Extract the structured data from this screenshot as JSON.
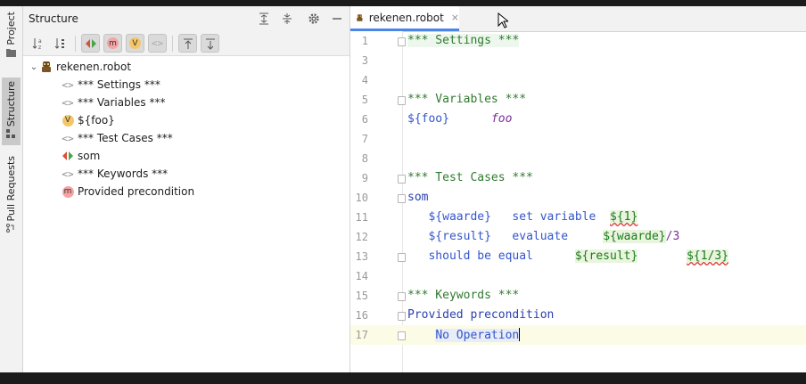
{
  "left_strip": {
    "tabs": [
      {
        "label": "Project",
        "icon": "folder-icon"
      },
      {
        "label": "Structure",
        "icon": "structure-icon"
      },
      {
        "label": "Pull Requests",
        "icon": "pull-request-icon"
      }
    ]
  },
  "structure": {
    "title": "Structure",
    "root": {
      "label": "rekenen.robot",
      "icon": "robot-file-icon"
    },
    "items": [
      {
        "label": "*** Settings ***",
        "type": "section"
      },
      {
        "label": "*** Variables ***",
        "type": "section"
      },
      {
        "label": "${foo}",
        "type": "variable",
        "badge": "V"
      },
      {
        "label": "*** Test Cases ***",
        "type": "section"
      },
      {
        "label": "som",
        "type": "testcase"
      },
      {
        "label": "*** Keywords ***",
        "type": "section"
      },
      {
        "label": "Provided precondition",
        "type": "keyword",
        "badge": "m"
      }
    ],
    "toolbar_badges": {
      "m": "m",
      "v": "V"
    }
  },
  "editor": {
    "tab": {
      "label": "rekenen.robot",
      "close": "×"
    },
    "lines": [
      {
        "n": "1",
        "parts": [
          "*** Settings ***"
        ]
      },
      {
        "n": "3",
        "parts": []
      },
      {
        "n": "4",
        "parts": []
      },
      {
        "n": "5",
        "parts": [
          "*** Variables ***"
        ]
      },
      {
        "n": "6",
        "parts": [
          "${foo}",
          "foo"
        ]
      },
      {
        "n": "7",
        "parts": []
      },
      {
        "n": "8",
        "parts": []
      },
      {
        "n": "9",
        "parts": [
          "*** Test Cases ***"
        ]
      },
      {
        "n": "10",
        "parts": [
          "som"
        ]
      },
      {
        "n": "11",
        "parts": [
          "${waarde}",
          "set variable",
          "${1}"
        ]
      },
      {
        "n": "12",
        "parts": [
          "${result}",
          "evaluate",
          "${waarde}",
          "/3"
        ]
      },
      {
        "n": "13",
        "parts": [
          "should be equal",
          "${result}",
          "${1/3}"
        ]
      },
      {
        "n": "14",
        "parts": []
      },
      {
        "n": "15",
        "parts": [
          "*** Keywords ***"
        ]
      },
      {
        "n": "16",
        "parts": [
          "Provided precondition"
        ]
      },
      {
        "n": "17",
        "parts": [
          "No Operation"
        ]
      }
    ]
  },
  "colors": {
    "section": "#2f7a2f",
    "keyword": "#2b3fae",
    "variable": "#3355cc",
    "literal": "#7b2e9a",
    "tab_underline": "#4a86e8"
  }
}
